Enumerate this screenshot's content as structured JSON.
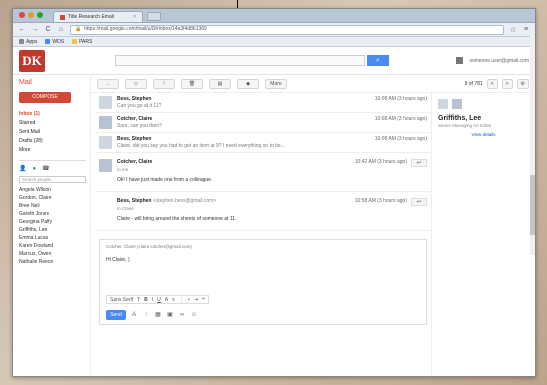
{
  "browser": {
    "tab_title": "Title Research Email",
    "tab_close": "×",
    "address": "https://mail.google.com/mail/u/0/#inbox/14a3f4d8b1369",
    "address_secure": "https",
    "bookmarks": [
      "Apps",
      "WDS",
      "PARS"
    ],
    "back": "←",
    "forward": "→",
    "reload": "C",
    "home": "⌂",
    "star": "☆",
    "menu": "≡"
  },
  "header": {
    "logo": "DK",
    "search_icon": "🔍",
    "user_email": "someone.user@gmail.com"
  },
  "leftnav": {
    "mail_label": "Mail",
    "compose": "COMPOSE",
    "items": [
      "Inbox (1)",
      "Starred",
      "Sent Mail",
      "Drafts (28)",
      "More"
    ],
    "contacts": [
      "Angela Wilson",
      "Gordon, Claire",
      "Bree Neil",
      "Gareth Jones",
      "Georgina Palfy",
      "Griffiths, Lee",
      "Emma Lucas",
      "Karen Dowland",
      "Marcus, Owen",
      "Nathalie Reece"
    ],
    "contact_search_placeholder": "Search people..."
  },
  "toolbar": {
    "back": "←",
    "archive": "▭",
    "spam": "!",
    "delete": "🗑",
    "move": "▤",
    "labels": "◆",
    "more": "More",
    "count": "9 of 781",
    "prev": "<",
    "next": ">",
    "settings": "⚙"
  },
  "thread": {
    "messages": [
      {
        "sender": "Bess, Stephen",
        "time": "10:08 AM (3 hours ago)",
        "snippet": "Can you go at it 11?"
      },
      {
        "sender": "Cotcher, Claire",
        "time": "10:08 AM (3 hours ago)",
        "snippet": "Sure, can you then?"
      },
      {
        "sender": "Bess, Stephen",
        "time": "10:08 AM (3 hours ago)",
        "snippet": "Claire, did you say you had to get an item at 9? I need everything on to be..."
      },
      {
        "sender": "Cotcher, Claire",
        "time": "10:42 AM (3 hours ago)",
        "to": "to me",
        "text": "Ok! I have just made one from a colleague."
      },
      {
        "sender": "Bess, Stephen",
        "sender_email": "<stephen.bess@gmail.com>",
        "time": "10:58 AM (3 hours ago)",
        "to": "to Claire",
        "text": "Claire - will bring around the sheets of someone at 11."
      }
    ]
  },
  "composer": {
    "header": "Cotcher, Claire (claire.cotcher@gmail.com)",
    "body": "Hi Claire, )",
    "font": "Sans Serif",
    "send": "Send",
    "icons": [
      "A",
      "↑",
      "▦",
      "▣",
      "∞",
      "☺"
    ]
  },
  "sidepanel": {
    "name": "Griffiths, Lee",
    "role": "Senior Managing Art Editor",
    "link": "View details"
  }
}
